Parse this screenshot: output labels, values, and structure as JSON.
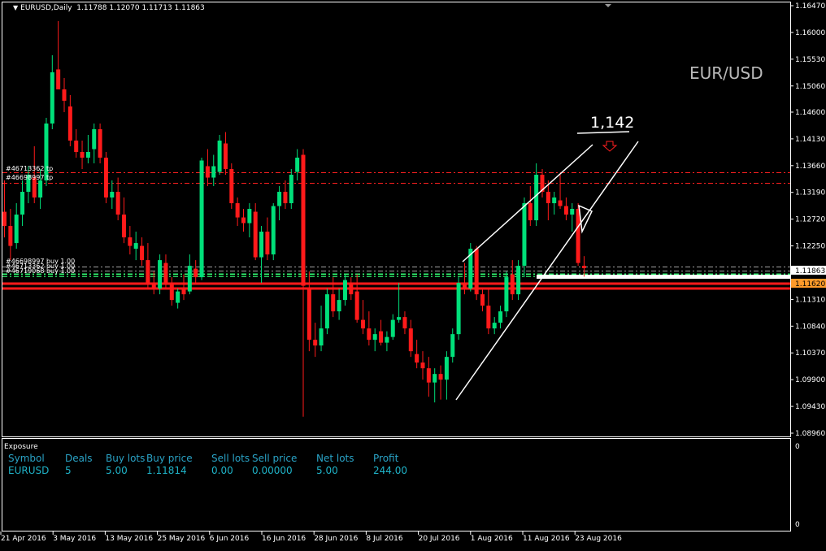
{
  "header": {
    "symbol_period": "EURUSD,Daily",
    "ohlc": "1.11788 1.12070 1.11713 1.11863"
  },
  "watermark": "EUR/USD",
  "target_label": "1,142",
  "order_tags": {
    "tp1": "#46713362 tp",
    "tp2": "#46698997 tp",
    "buy1": "#46698997 buy 1.00",
    "buy2": "#46713362 buy 1.00",
    "buy3": "#46719068 buy 1.00"
  },
  "price_axis": {
    "ticks": [
      "1.16470",
      "1.16000",
      "1.15530",
      "1.15060",
      "1.14600",
      "1.14130",
      "1.13660",
      "1.13190",
      "1.12720",
      "1.12250",
      "1.11310",
      "1.10840",
      "1.10370",
      "1.09900",
      "1.09430",
      "1.08960"
    ],
    "current_price": "1.11863",
    "line_price": "1.11620"
  },
  "exposure_axis": {
    "top": "0",
    "bottom": "0"
  },
  "time_axis": [
    "21 Apr 2016",
    "3 May 2016",
    "13 May 2016",
    "25 May 2016",
    "6 Jun 2016",
    "16 Jun 2016",
    "28 Jun 2016",
    "8 Jul 2016",
    "20 Jul 2016",
    "1 Aug 2016",
    "11 Aug 2016",
    "23 Aug 2016"
  ],
  "exposure": {
    "title": "Exposure",
    "headers": {
      "symbol": "Symbol",
      "deals": "Deals",
      "buy_lots": "Buy lots",
      "buy_price": "Buy price",
      "sell_lots": "Sell lots",
      "sell_price": "Sell price",
      "net_lots": "Net lots",
      "profit": "Profit"
    },
    "row": {
      "symbol": "EURUSD",
      "deals": "5",
      "buy_lots": "5.00",
      "buy_price": "1.11814",
      "sell_lots": "0.00",
      "sell_price": "0.00000",
      "net_lots": "5.00",
      "profit": "244.00"
    }
  },
  "colors": {
    "bull": "#00e07a",
    "bear": "#ff1a1a",
    "background": "#000000",
    "grid_text": "#ffffff",
    "accent_blue": "#2aa3c6"
  },
  "chart_data": {
    "type": "candlestick",
    "symbol": "EURUSD",
    "timeframe": "Daily",
    "y_range": [
      1.0896,
      1.1647
    ],
    "candles": [
      {
        "o": 1.1285,
        "h": 1.134,
        "l": 1.124,
        "c": 1.126
      },
      {
        "o": 1.126,
        "h": 1.129,
        "l": 1.12,
        "c": 1.1225
      },
      {
        "o": 1.123,
        "h": 1.13,
        "l": 1.122,
        "c": 1.128
      },
      {
        "o": 1.128,
        "h": 1.134,
        "l": 1.126,
        "c": 1.132
      },
      {
        "o": 1.132,
        "h": 1.1365,
        "l": 1.13,
        "c": 1.135
      },
      {
        "o": 1.1345,
        "h": 1.14,
        "l": 1.13,
        "c": 1.131
      },
      {
        "o": 1.131,
        "h": 1.136,
        "l": 1.129,
        "c": 1.134
      },
      {
        "o": 1.134,
        "h": 1.145,
        "l": 1.133,
        "c": 1.144
      },
      {
        "o": 1.144,
        "h": 1.156,
        "l": 1.143,
        "c": 1.153
      },
      {
        "o": 1.1535,
        "h": 1.162,
        "l": 1.15,
        "c": 1.15
      },
      {
        "o": 1.15,
        "h": 1.152,
        "l": 1.146,
        "c": 1.148
      },
      {
        "o": 1.147,
        "h": 1.149,
        "l": 1.14,
        "c": 1.141
      },
      {
        "o": 1.141,
        "h": 1.143,
        "l": 1.138,
        "c": 1.139
      },
      {
        "o": 1.139,
        "h": 1.141,
        "l": 1.136,
        "c": 1.138
      },
      {
        "o": 1.138,
        "h": 1.142,
        "l": 1.137,
        "c": 1.139
      },
      {
        "o": 1.1395,
        "h": 1.144,
        "l": 1.137,
        "c": 1.143
      },
      {
        "o": 1.143,
        "h": 1.144,
        "l": 1.137,
        "c": 1.138
      },
      {
        "o": 1.138,
        "h": 1.139,
        "l": 1.13,
        "c": 1.131
      },
      {
        "o": 1.131,
        "h": 1.134,
        "l": 1.129,
        "c": 1.132
      },
      {
        "o": 1.132,
        "h": 1.1345,
        "l": 1.127,
        "c": 1.128
      },
      {
        "o": 1.128,
        "h": 1.131,
        "l": 1.123,
        "c": 1.124
      },
      {
        "o": 1.124,
        "h": 1.126,
        "l": 1.121,
        "c": 1.1225
      },
      {
        "o": 1.122,
        "h": 1.125,
        "l": 1.12,
        "c": 1.123
      },
      {
        "o": 1.1225,
        "h": 1.124,
        "l": 1.119,
        "c": 1.12
      },
      {
        "o": 1.12,
        "h": 1.123,
        "l": 1.115,
        "c": 1.116
      },
      {
        "o": 1.116,
        "h": 1.118,
        "l": 1.114,
        "c": 1.115
      },
      {
        "o": 1.115,
        "h": 1.121,
        "l": 1.114,
        "c": 1.12
      },
      {
        "o": 1.1195,
        "h": 1.121,
        "l": 1.115,
        "c": 1.116
      },
      {
        "o": 1.116,
        "h": 1.117,
        "l": 1.112,
        "c": 1.113
      },
      {
        "o": 1.1125,
        "h": 1.115,
        "l": 1.1115,
        "c": 1.1145
      },
      {
        "o": 1.115,
        "h": 1.1175,
        "l": 1.113,
        "c": 1.114
      },
      {
        "o": 1.1145,
        "h": 1.121,
        "l": 1.114,
        "c": 1.119
      },
      {
        "o": 1.1185,
        "h": 1.12,
        "l": 1.116,
        "c": 1.117
      },
      {
        "o": 1.117,
        "h": 1.138,
        "l": 1.1165,
        "c": 1.1375
      },
      {
        "o": 1.1365,
        "h": 1.1395,
        "l": 1.133,
        "c": 1.1345
      },
      {
        "o": 1.1345,
        "h": 1.1385,
        "l": 1.133,
        "c": 1.1365
      },
      {
        "o": 1.1355,
        "h": 1.142,
        "l": 1.135,
        "c": 1.141
      },
      {
        "o": 1.1405,
        "h": 1.1425,
        "l": 1.135,
        "c": 1.136
      },
      {
        "o": 1.136,
        "h": 1.137,
        "l": 1.129,
        "c": 1.13
      },
      {
        "o": 1.13,
        "h": 1.131,
        "l": 1.126,
        "c": 1.1275
      },
      {
        "o": 1.1275,
        "h": 1.129,
        "l": 1.125,
        "c": 1.1265
      },
      {
        "o": 1.1265,
        "h": 1.13,
        "l": 1.124,
        "c": 1.129
      },
      {
        "o": 1.1285,
        "h": 1.13,
        "l": 1.12,
        "c": 1.1205
      },
      {
        "o": 1.1205,
        "h": 1.126,
        "l": 1.116,
        "c": 1.125
      },
      {
        "o": 1.125,
        "h": 1.1275,
        "l": 1.12,
        "c": 1.121
      },
      {
        "o": 1.121,
        "h": 1.13,
        "l": 1.12,
        "c": 1.1295
      },
      {
        "o": 1.1295,
        "h": 1.133,
        "l": 1.127,
        "c": 1.132
      },
      {
        "o": 1.132,
        "h": 1.134,
        "l": 1.129,
        "c": 1.13
      },
      {
        "o": 1.13,
        "h": 1.136,
        "l": 1.129,
        "c": 1.135
      },
      {
        "o": 1.1355,
        "h": 1.1395,
        "l": 1.134,
        "c": 1.138
      },
      {
        "o": 1.1385,
        "h": 1.1395,
        "l": 1.0925,
        "c": 1.1155
      },
      {
        "o": 1.115,
        "h": 1.118,
        "l": 1.104,
        "c": 1.106
      },
      {
        "o": 1.106,
        "h": 1.109,
        "l": 1.103,
        "c": 1.105
      },
      {
        "o": 1.105,
        "h": 1.112,
        "l": 1.104,
        "c": 1.108
      },
      {
        "o": 1.108,
        "h": 1.115,
        "l": 1.107,
        "c": 1.114
      },
      {
        "o": 1.114,
        "h": 1.117,
        "l": 1.11,
        "c": 1.111
      },
      {
        "o": 1.111,
        "h": 1.115,
        "l": 1.1095,
        "c": 1.113
      },
      {
        "o": 1.113,
        "h": 1.1175,
        "l": 1.112,
        "c": 1.1165
      },
      {
        "o": 1.116,
        "h": 1.117,
        "l": 1.113,
        "c": 1.114
      },
      {
        "o": 1.1145,
        "h": 1.1175,
        "l": 1.109,
        "c": 1.1095
      },
      {
        "o": 1.1095,
        "h": 1.113,
        "l": 1.107,
        "c": 1.108
      },
      {
        "o": 1.108,
        "h": 1.111,
        "l": 1.105,
        "c": 1.106
      },
      {
        "o": 1.106,
        "h": 1.108,
        "l": 1.104,
        "c": 1.107
      },
      {
        "o": 1.1075,
        "h": 1.1095,
        "l": 1.105,
        "c": 1.1055
      },
      {
        "o": 1.1055,
        "h": 1.1075,
        "l": 1.104,
        "c": 1.1065
      },
      {
        "o": 1.1065,
        "h": 1.1105,
        "l": 1.106,
        "c": 1.1095
      },
      {
        "o": 1.1095,
        "h": 1.116,
        "l": 1.109,
        "c": 1.11
      },
      {
        "o": 1.11,
        "h": 1.111,
        "l": 1.107,
        "c": 1.108
      },
      {
        "o": 1.108,
        "h": 1.1095,
        "l": 1.103,
        "c": 1.104
      },
      {
        "o": 1.1035,
        "h": 1.106,
        "l": 1.101,
        "c": 1.102
      },
      {
        "o": 1.102,
        "h": 1.104,
        "l": 1.099,
        "c": 1.101
      },
      {
        "o": 1.101,
        "h": 1.103,
        "l": 1.096,
        "c": 1.0985
      },
      {
        "o": 1.0985,
        "h": 1.101,
        "l": 1.095,
        "c": 1.1
      },
      {
        "o": 1.1,
        "h": 1.1015,
        "l": 1.0955,
        "c": 1.099
      },
      {
        "o": 1.099,
        "h": 1.104,
        "l": 1.0955,
        "c": 1.103
      },
      {
        "o": 1.103,
        "h": 1.108,
        "l": 1.102,
        "c": 1.107
      },
      {
        "o": 1.107,
        "h": 1.117,
        "l": 1.106,
        "c": 1.116
      },
      {
        "o": 1.116,
        "h": 1.1195,
        "l": 1.114,
        "c": 1.115
      },
      {
        "o": 1.115,
        "h": 1.123,
        "l": 1.1145,
        "c": 1.122
      },
      {
        "o": 1.122,
        "h": 1.1225,
        "l": 1.113,
        "c": 1.114
      },
      {
        "o": 1.114,
        "h": 1.115,
        "l": 1.111,
        "c": 1.112
      },
      {
        "o": 1.112,
        "h": 1.115,
        "l": 1.107,
        "c": 1.108
      },
      {
        "o": 1.108,
        "h": 1.11,
        "l": 1.107,
        "c": 1.109
      },
      {
        "o": 1.109,
        "h": 1.112,
        "l": 1.108,
        "c": 1.111
      },
      {
        "o": 1.111,
        "h": 1.118,
        "l": 1.11,
        "c": 1.117
      },
      {
        "o": 1.1175,
        "h": 1.12,
        "l": 1.113,
        "c": 1.114
      },
      {
        "o": 1.114,
        "h": 1.12,
        "l": 1.113,
        "c": 1.119
      },
      {
        "o": 1.119,
        "h": 1.131,
        "l": 1.117,
        "c": 1.13
      },
      {
        "o": 1.13,
        "h": 1.133,
        "l": 1.126,
        "c": 1.127
      },
      {
        "o": 1.127,
        "h": 1.137,
        "l": 1.126,
        "c": 1.135
      },
      {
        "o": 1.135,
        "h": 1.136,
        "l": 1.131,
        "c": 1.132
      },
      {
        "o": 1.132,
        "h": 1.134,
        "l": 1.127,
        "c": 1.13
      },
      {
        "o": 1.13,
        "h": 1.132,
        "l": 1.128,
        "c": 1.131
      },
      {
        "o": 1.1305,
        "h": 1.135,
        "l": 1.129,
        "c": 1.1295
      },
      {
        "o": 1.1295,
        "h": 1.131,
        "l": 1.127,
        "c": 1.128
      },
      {
        "o": 1.128,
        "h": 1.13,
        "l": 1.125,
        "c": 1.129
      },
      {
        "o": 1.129,
        "h": 1.13,
        "l": 1.119,
        "c": 1.1195
      },
      {
        "o": 1.119,
        "h": 1.1207,
        "l": 1.1171,
        "c": 1.1186
      }
    ]
  }
}
